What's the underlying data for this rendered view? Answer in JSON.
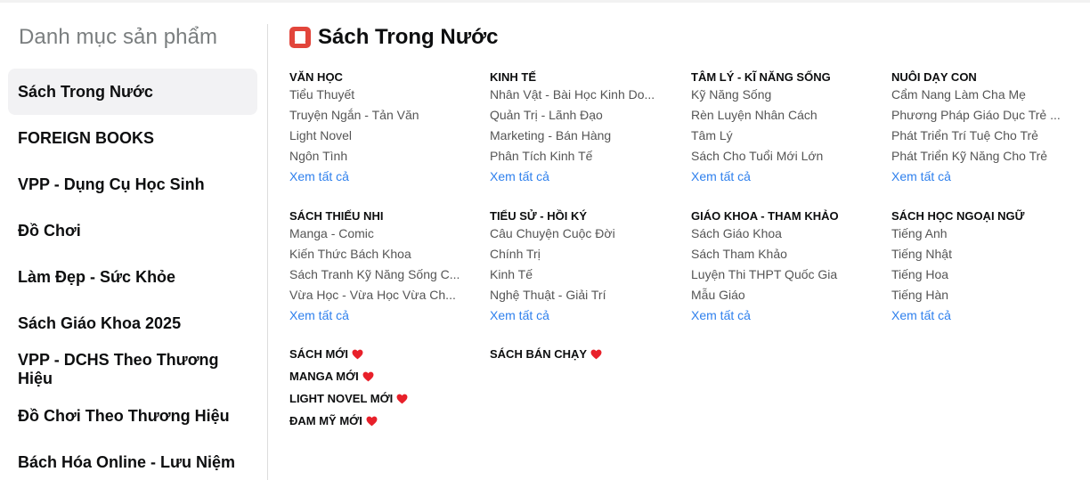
{
  "sidebar": {
    "title": "Danh mục sản phẩm",
    "items": [
      {
        "label": "Sách Trong Nước",
        "active": true
      },
      {
        "label": "FOREIGN BOOKS"
      },
      {
        "label": "VPP - Dụng Cụ Học Sinh"
      },
      {
        "label": "Đồ Chơi"
      },
      {
        "label": "Làm Đẹp - Sức Khỏe"
      },
      {
        "label": "Sách Giáo Khoa 2025"
      },
      {
        "label": "VPP - DCHS Theo Thương Hiệu"
      },
      {
        "label": "Đồ Chơi Theo Thương Hiệu"
      },
      {
        "label": "Bách Hóa Online - Lưu Niệm"
      }
    ]
  },
  "main": {
    "title": "Sách Trong Nước",
    "title_icon": "book-icon",
    "categories": [
      {
        "heading": "VĂN HỌC",
        "links": [
          "Tiểu Thuyết",
          "Truyện Ngắn - Tản Văn",
          "Light Novel",
          "Ngôn Tình"
        ]
      },
      {
        "heading": "KINH TẾ",
        "links": [
          "Nhân Vật - Bài Học Kinh Do...",
          "Quản Trị - Lãnh Đạo",
          "Marketing - Bán Hàng",
          "Phân Tích Kinh Tế"
        ]
      },
      {
        "heading": "TÂM LÝ - KĨ NĂNG SỐNG",
        "links": [
          "Kỹ Năng Sống",
          "Rèn Luyện Nhân Cách",
          "Tâm Lý",
          "Sách Cho Tuổi Mới Lớn"
        ]
      },
      {
        "heading": "NUÔI DẠY CON",
        "links": [
          "Cẩm Nang Làm Cha Mẹ",
          "Phương Pháp Giáo Dục Trẻ ...",
          "Phát Triển Trí Tuệ Cho Trẻ",
          "Phát Triển Kỹ Năng Cho Trẻ"
        ]
      },
      {
        "heading": "SÁCH THIẾU NHI",
        "links": [
          "Manga - Comic",
          "Kiến Thức Bách Khoa",
          "Sách Tranh Kỹ Năng Sống C...",
          "Vừa Học - Vừa Học Vừa Ch..."
        ]
      },
      {
        "heading": "TIỂU SỬ - HỒI KÝ",
        "links": [
          "Câu Chuyện Cuộc Đời",
          "Chính Trị",
          "Kinh Tế",
          "Nghệ Thuật - Giải Trí"
        ]
      },
      {
        "heading": "GIÁO KHOA - THAM KHẢO",
        "links": [
          "Sách Giáo Khoa",
          "Sách Tham Khảo",
          "Luyện Thi THPT Quốc Gia",
          "Mẫu Giáo"
        ]
      },
      {
        "heading": "SÁCH HỌC NGOẠI NGỮ",
        "links": [
          "Tiếng Anh",
          "Tiếng Nhật",
          "Tiếng Hoa",
          "Tiếng Hàn"
        ]
      }
    ],
    "see_all_label": "Xem tất cả",
    "specials_col1": [
      "SÁCH MỚI",
      "MANGA MỚI",
      "LIGHT NOVEL MỚI",
      "ĐAM MỸ MỚI"
    ],
    "specials_col2": [
      "SÁCH BÁN CHẠY"
    ],
    "special_icon": "heart-icon"
  },
  "colors": {
    "accent_link": "#2f80ed",
    "heart": "#e8202a",
    "active_bg": "#f2f2f4",
    "title_icon": "#e2453b"
  }
}
